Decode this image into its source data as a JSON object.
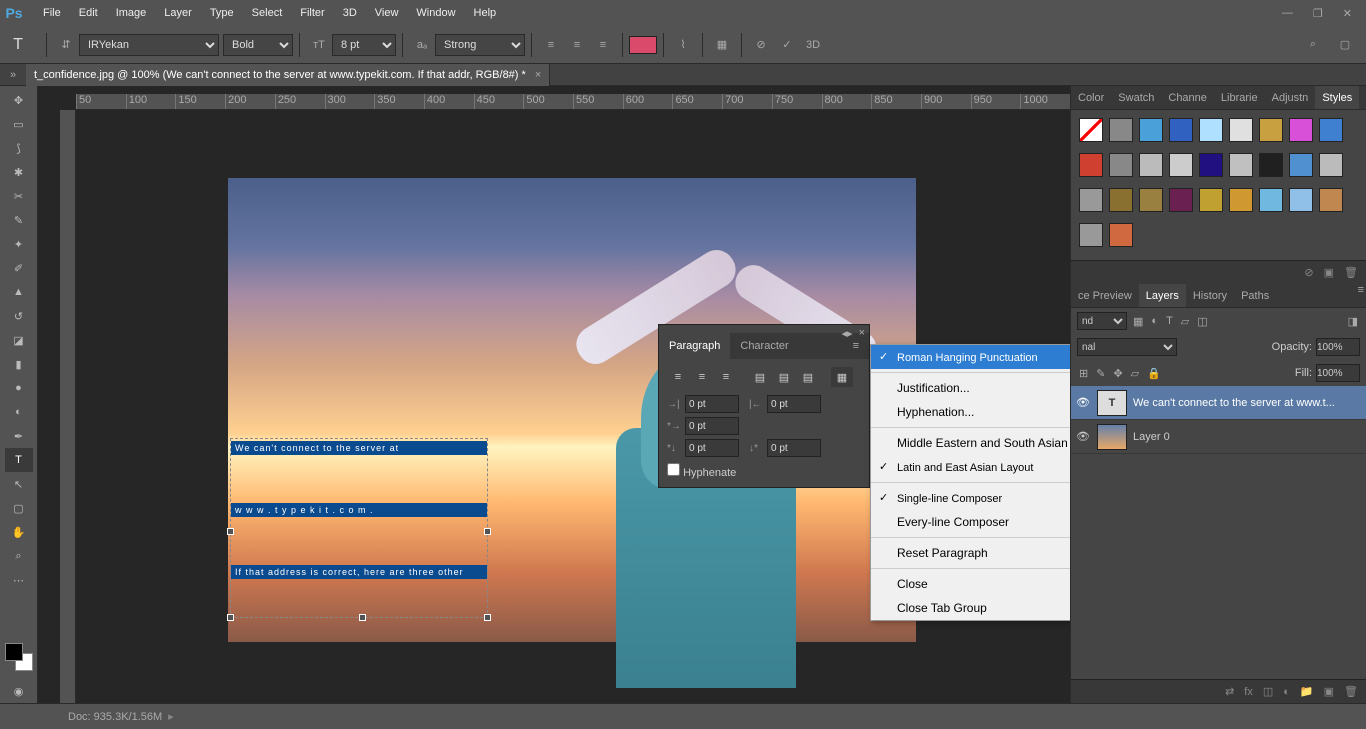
{
  "app": {
    "logo": "Ps"
  },
  "menu": [
    "File",
    "Edit",
    "Image",
    "Layer",
    "Type",
    "Select",
    "Filter",
    "3D",
    "View",
    "Window",
    "Help"
  ],
  "options": {
    "font": "IRYekan",
    "weight": "Bold",
    "size": "8 pt",
    "aa": "Strong",
    "swatch": "#d94a6b",
    "threeD": "3D"
  },
  "doc": {
    "title": "t_confidence.jpg @ 100% (We can't connect to  the server at www.typekit.com. If that addr, RGB/8#) *"
  },
  "ruler": [
    "50",
    "100",
    "150",
    "200",
    "250",
    "300",
    "350",
    "400",
    "450",
    "500",
    "550",
    "600",
    "650",
    "700",
    "750",
    "800",
    "850",
    "900",
    "950",
    "1000"
  ],
  "text": {
    "l1": "We  can't  connect  to  the  server  at",
    "l2": "w w w . t y p e k i t . c o m .",
    "l3": "If that address is correct, here are three other"
  },
  "paragraph": {
    "tab1": "Paragraph",
    "tab2": "Character",
    "indentLeft": "0 pt",
    "indentRight": "0 pt",
    "firstLine": "0 pt",
    "spaceBefore": "0 pt",
    "spaceAfter": "0 pt",
    "hyphenate": "Hyphenate"
  },
  "ctx": {
    "roman": "Roman Hanging Punctuation",
    "justification": "Justification...",
    "hyphenation": "Hyphenation...",
    "mideast": "Middle Eastern and South Asian Layout",
    "latin": "Latin and East Asian Layout",
    "single": "Single-line Composer",
    "every": "Every-line Composer",
    "reset": "Reset Paragraph",
    "close": "Close",
    "closeGroup": "Close Tab Group"
  },
  "rightTabs": {
    "color": "Color",
    "swatch": "Swatch",
    "chan": "Channe",
    "lib": "Librarie",
    "adj": "Adjustn",
    "styles": "Styles"
  },
  "layersTabs": {
    "preview": "ce Preview",
    "layers": "Layers",
    "history": "History",
    "paths": "Paths"
  },
  "layers": {
    "kind": "nd",
    "blend": "nal",
    "opacityLabel": "Opacity:",
    "opacity": "100%",
    "fillLabel": "Fill:",
    "fill": "100%",
    "layer1": "We can't connect to the server at www.t...",
    "layer2": "Layer 0"
  },
  "status": {
    "doc": "Doc: 935.3K/1.56M"
  },
  "styleColors": [
    "#fff",
    "#888",
    "#4aa0d8",
    "#3060c0",
    "#b0e0ff",
    "#e0e0e0",
    "#c8a040",
    "#d850d8",
    "#4080d0",
    "#d04030",
    "#888",
    "#bbb",
    "#ccc",
    "#201080",
    "#c0c0c0",
    "#202020",
    "#5090d0",
    "#bbb",
    "#999",
    "#8a7030",
    "#9a8040",
    "#6a2050",
    "#bfa030",
    "#d09830",
    "#70b8e0",
    "#90c0e8",
    "#c08850",
    "#999",
    "#d06840"
  ]
}
